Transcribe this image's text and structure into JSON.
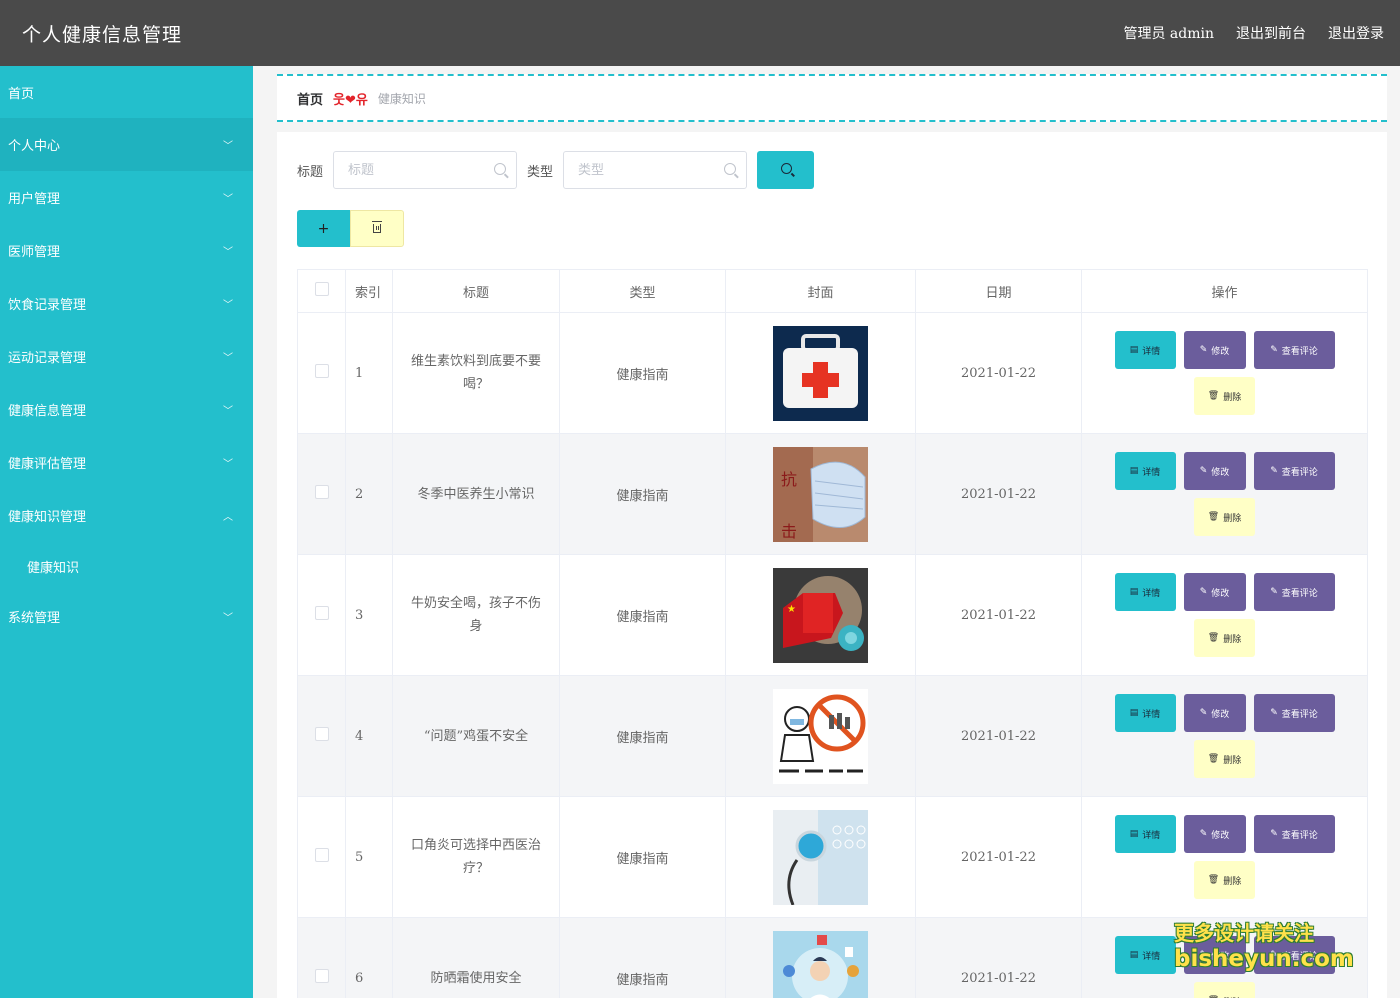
{
  "header": {
    "title": "个人健康信息管理",
    "actions": [
      "管理员 admin",
      "退出到前台",
      "退出登录"
    ]
  },
  "sidebar": {
    "home": "首页",
    "items": [
      {
        "label": "个人中心",
        "expanded": false
      },
      {
        "label": "用户管理",
        "expanded": false
      },
      {
        "label": "医师管理",
        "expanded": false
      },
      {
        "label": "饮食记录管理",
        "expanded": false
      },
      {
        "label": "运动记录管理",
        "expanded": false
      },
      {
        "label": "健康信息管理",
        "expanded": false
      },
      {
        "label": "健康评估管理",
        "expanded": false
      },
      {
        "label": "健康知识管理",
        "expanded": true
      }
    ],
    "sub_items": [
      "健康知识"
    ],
    "last_item": {
      "label": "系统管理",
      "expanded": false
    }
  },
  "breadcrumb": {
    "home": "首页",
    "separator": "웃❤유",
    "current": "健康知识"
  },
  "search": {
    "title_label": "标题",
    "title_placeholder": "标题",
    "type_label": "类型",
    "type_placeholder": "类型"
  },
  "actions": {
    "add_label": "+"
  },
  "table": {
    "headers": [
      "索引",
      "标题",
      "类型",
      "封面",
      "日期",
      "操作"
    ],
    "rows": [
      {
        "index": "1",
        "title": "维生素饮料到底要不要喝？",
        "type": "健康指南",
        "cover": "first-aid-kit",
        "date": "2021-01-22"
      },
      {
        "index": "2",
        "title": "冬季中医养生小常识",
        "type": "健康指南",
        "cover": "face-mask-poster",
        "date": "2021-01-22"
      },
      {
        "index": "3",
        "title": "牛奶安全喝，孩子不伤身",
        "type": "健康指南",
        "cover": "fist-virus-poster",
        "date": "2021-01-22"
      },
      {
        "index": "4",
        "title": "“问题”鸡蛋不安全",
        "type": "健康指南",
        "cover": "no-gathering-poster",
        "date": "2021-01-22"
      },
      {
        "index": "5",
        "title": "口角炎可选择中西医治疗？",
        "type": "健康指南",
        "cover": "stethoscope-doctor",
        "date": "2021-01-22"
      },
      {
        "index": "6",
        "title": "防晒霜使用安全",
        "type": "健康指南",
        "cover": "doctor-illustration",
        "date": "2021-01-22"
      }
    ],
    "op_labels": {
      "detail": "详情",
      "edit": "修改",
      "comment": "查看评论",
      "delete": "删除"
    }
  },
  "watermark": {
    "line1": "更多设计请关注",
    "line2": "bisheyun.com"
  },
  "colors": {
    "header_bg": "#4a4a4a",
    "sidebar_bg": "#23bfcc",
    "accent": "#23bfcc",
    "purple": "#6b5d9c",
    "yellow": "#ffffc6"
  }
}
